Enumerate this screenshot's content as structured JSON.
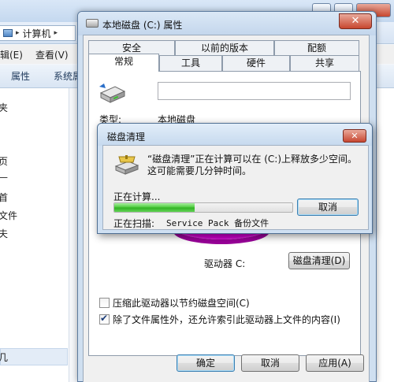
{
  "explorer": {
    "address": {
      "label": "计算机",
      "separator": "▸",
      "arrow": "▸"
    },
    "menubar": {
      "edit": "辑(E)",
      "view": "查看(V)"
    },
    "toolbar": {
      "properties": "属性",
      "system": "系统属"
    },
    "nav": [
      "夹",
      "页",
      "—",
      "首",
      "文件",
      "夫",
      "几"
    ]
  },
  "properties_dialog": {
    "title": "本地磁盘 (C:) 属性",
    "close_glyph": "✕",
    "tabs_back": [
      "安全",
      "以前的版本",
      "配额"
    ],
    "tabs_front": [
      "常规",
      "工具",
      "硬件",
      "共享"
    ],
    "active_tab": "常规",
    "type_label": "类型:",
    "type_value": "本地磁盘",
    "drive_label": "驱动器 C:",
    "cleanup_button": "磁盘清理(D)",
    "compress_label": "压缩此驱动器以节约磁盘空间(C)",
    "compress_checked": false,
    "index_label": "除了文件属性外，还允许索引此驱动器上文件的内容(I)",
    "index_checked": true,
    "ok": "确定",
    "cancel": "取消",
    "apply": "应用(A)",
    "pie_color": "#cc00cc"
  },
  "cleanup_dialog": {
    "title": "磁盘清理",
    "close_glyph": "✕",
    "message": "“磁盘清理”正在计算可以在 (C:)上释放多少空间。这可能需要几分钟时间。",
    "calculating": "正在计算...",
    "scanning_label": "正在扫描:",
    "scanning_value": "Service Pack 备份文件",
    "cancel": "取消",
    "progress": 0.45,
    "progress_color": "#3cbf2e"
  }
}
